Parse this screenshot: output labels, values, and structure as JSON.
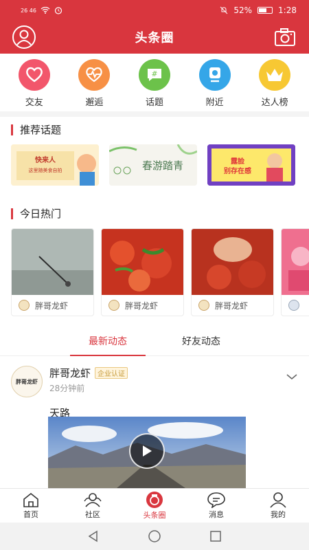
{
  "status_bar": {
    "signal_left": "26  46",
    "battery": "52%",
    "time": "1:28"
  },
  "header": {
    "title": "头条圈",
    "profile_icon": "user-circle-icon",
    "camera_icon": "camera-icon"
  },
  "features": [
    {
      "label": "交友",
      "icon": "heart-icon",
      "color": "#f2566b"
    },
    {
      "label": "邂逅",
      "icon": "heartbeat-icon",
      "color": "#f79045"
    },
    {
      "label": "话题",
      "icon": "hashtag-icon",
      "color": "#6cc24a"
    },
    {
      "label": "附近",
      "icon": "location-icon",
      "color": "#35a6e8"
    },
    {
      "label": "达人榜",
      "icon": "crown-icon",
      "color": "#f7c833"
    }
  ],
  "recommended": {
    "title": "推荐话题",
    "topics": [
      {
        "text": "快来人 这里随美食自拍"
      },
      {
        "text": "春游踏青"
      },
      {
        "text": "露脸 别存在感"
      }
    ]
  },
  "hot_today": {
    "title": "今日热门",
    "items": [
      {
        "author": "胖哥龙虾"
      },
      {
        "author": "胖哥龙虾"
      },
      {
        "author": "胖哥龙虾"
      },
      {
        "author": ""
      }
    ]
  },
  "tabs": [
    {
      "label": "最新动态",
      "active": true
    },
    {
      "label": "好友动态",
      "active": false
    }
  ],
  "post": {
    "author": "胖哥龙虾",
    "avatar_text": "胖哥龙虾",
    "badge": "企业认证",
    "time": "28分钟前",
    "text": "天路"
  },
  "bottom_nav": [
    {
      "label": "首页",
      "icon": "home-icon"
    },
    {
      "label": "社区",
      "icon": "community-icon"
    },
    {
      "label": "头条圈",
      "icon": "headline-circle-icon",
      "active": true
    },
    {
      "label": "消息",
      "icon": "message-icon"
    },
    {
      "label": "我的",
      "icon": "profile-icon"
    }
  ],
  "colors": {
    "brand": "#d9363e",
    "badge": "#c59a3a"
  }
}
